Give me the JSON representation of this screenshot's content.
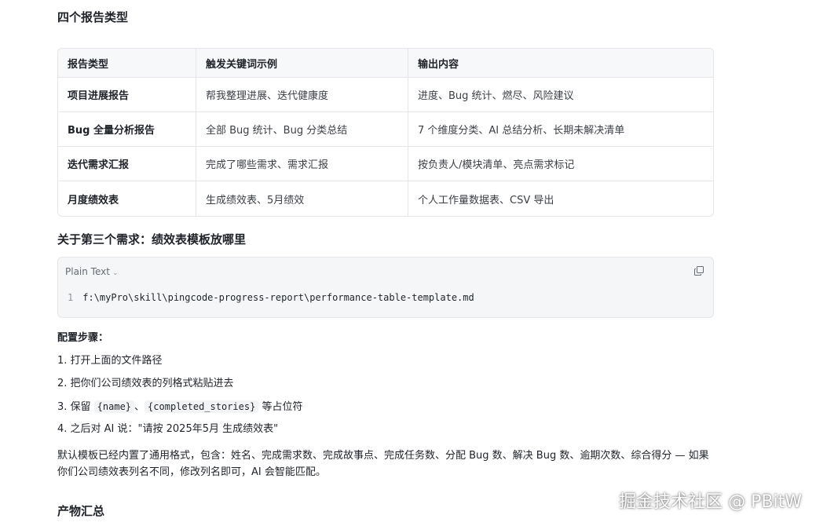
{
  "section1": {
    "title": "四个报告类型"
  },
  "table": {
    "headers": [
      "报告类型",
      "触发关键词示例",
      "输出内容"
    ],
    "rows": [
      [
        "项目进展报告",
        "帮我整理进展、迭代健康度",
        "进度、Bug 统计、燃尽、风险建议"
      ],
      [
        "Bug 全量分析报告",
        "全部 Bug 统计、Bug 分类总结",
        "7 个维度分类、AI 总结分析、长期未解决清单"
      ],
      [
        "迭代需求汇报",
        "完成了哪些需求、需求汇报",
        "按负责人/模块清单、亮点需求标记"
      ],
      [
        "月度绩效表",
        "生成绩效表、5月绩效",
        "个人工作量数据表、CSV 导出"
      ]
    ]
  },
  "section2": {
    "title": "关于第三个需求：绩效表模板放哪里"
  },
  "code": {
    "language": "Plain Text",
    "line_number": "1",
    "content": "f:\\myPro\\skill\\pingcode-progress-report\\performance-table-template.md"
  },
  "steps": {
    "title": "配置步骤：",
    "item1": "1. 打开上面的文件路径",
    "item2": "2. 把你们公司绩效表的列格式粘贴进去",
    "item3_prefix": "3. 保留 ",
    "item3_code1": "{name}",
    "item3_sep": "、",
    "item3_code2": "{completed_stories}",
    "item3_suffix": " 等占位符",
    "item4": "4. 之后对 AI 说：\"请按 2025年5月 生成绩效表\""
  },
  "paragraph": "默认模板已经内置了通用格式，包含：姓名、完成需求数、完成故事点、完成任务数、分配 Bug 数、解决 Bug 数、逾期次数、综合得分 — 如果你们公司绩效表列名不同，修改列名即可，AI 会智能匹配。",
  "section3": {
    "title": "产物汇总"
  },
  "watermark": "掘金技术社区 @ PBitW"
}
